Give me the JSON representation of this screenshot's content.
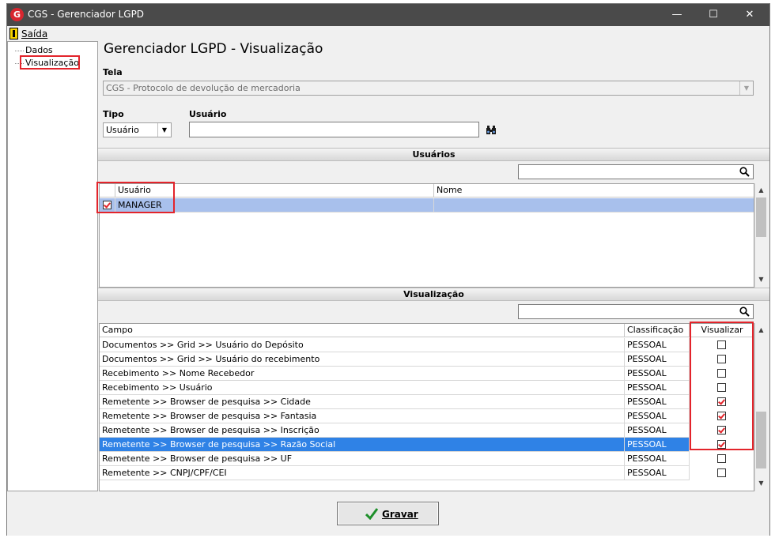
{
  "window": {
    "title": "CGS - Gerenciador LGPD",
    "app_icon_letter": "G"
  },
  "menubar": {
    "exit_label": "Saída"
  },
  "tree": {
    "items": [
      {
        "label": "Dados",
        "highlighted": false
      },
      {
        "label": "Visualização",
        "highlighted": true
      }
    ]
  },
  "page_title": "Gerenciador LGPD - Visualização",
  "screen_field": {
    "label": "Tela",
    "value": "CGS - Protocolo de devolução de mercadoria"
  },
  "type_field": {
    "label": "Tipo",
    "value": "Usuário"
  },
  "user_field": {
    "label": "Usuário",
    "value": ""
  },
  "users_section": {
    "title": "Usuários",
    "search_value": "",
    "columns": [
      "Usuário",
      "Nome"
    ],
    "rows": [
      {
        "checked": true,
        "user": "MANAGER",
        "name": "",
        "selected": true
      }
    ]
  },
  "view_section": {
    "title": "Visualização",
    "search_value": "",
    "columns": [
      "Campo",
      "Classificação",
      "Visualizar"
    ],
    "rows": [
      {
        "field": "Documentos >> Grid >> Usuário do Depósito",
        "class": "PESSOAL",
        "view": false,
        "selected": false
      },
      {
        "field": "Documentos >> Grid >> Usuário do recebimento",
        "class": "PESSOAL",
        "view": false,
        "selected": false
      },
      {
        "field": "Recebimento >> Nome Recebedor",
        "class": "PESSOAL",
        "view": false,
        "selected": false
      },
      {
        "field": "Recebimento >> Usuário",
        "class": "PESSOAL",
        "view": false,
        "selected": false
      },
      {
        "field": "Remetente >> Browser de pesquisa >> Cidade",
        "class": "PESSOAL",
        "view": true,
        "selected": false
      },
      {
        "field": "Remetente >> Browser de pesquisa >> Fantasia",
        "class": "PESSOAL",
        "view": true,
        "selected": false
      },
      {
        "field": "Remetente >> Browser de pesquisa >> Inscrição",
        "class": "PESSOAL",
        "view": true,
        "selected": false
      },
      {
        "field": "Remetente >> Browser de pesquisa >> Razão Social",
        "class": "PESSOAL",
        "view": true,
        "selected": true
      },
      {
        "field": "Remetente >> Browser de pesquisa >> UF",
        "class": "PESSOAL",
        "view": false,
        "selected": false
      },
      {
        "field": "Remetente >> CNPJ/CPF/CEI",
        "class": "PESSOAL",
        "view": false,
        "selected": false
      }
    ]
  },
  "save_button": {
    "label": "Gravar"
  },
  "colors": {
    "titlebar": "#4a4a4a",
    "highlight_box": "#e3242b",
    "selected_row": "#2f82e6",
    "selected_user_row": "#a8c0ec"
  }
}
